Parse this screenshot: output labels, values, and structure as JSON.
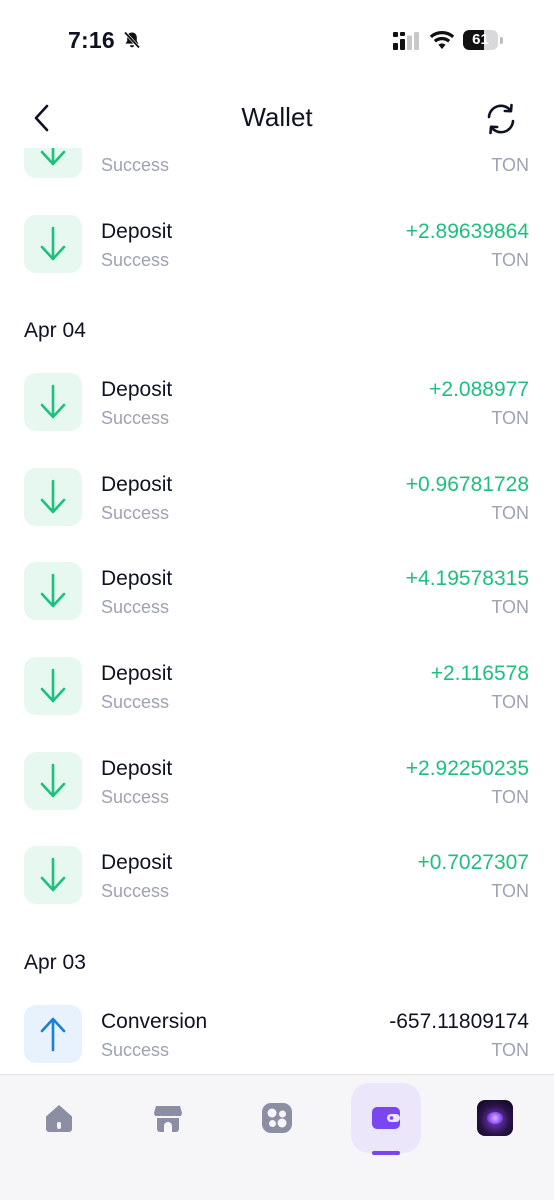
{
  "status_bar": {
    "time": "7:16",
    "battery": "61",
    "battery_level": 0.61
  },
  "header": {
    "title": "Wallet"
  },
  "partial_row": {
    "type": "in",
    "status": "Success",
    "currency": "TON"
  },
  "groups": [
    {
      "date": "",
      "rows": [
        {
          "type": "in",
          "title": "Deposit",
          "status": "Success",
          "amount": "+2.89639864",
          "currency": "TON"
        }
      ]
    },
    {
      "date": "Apr 04",
      "rows": [
        {
          "type": "in",
          "title": "Deposit",
          "status": "Success",
          "amount": "+2.088977",
          "currency": "TON"
        },
        {
          "type": "in",
          "title": "Deposit",
          "status": "Success",
          "amount": "+0.96781728",
          "currency": "TON"
        },
        {
          "type": "in",
          "title": "Deposit",
          "status": "Success",
          "amount": "+4.19578315",
          "currency": "TON"
        },
        {
          "type": "in",
          "title": "Deposit",
          "status": "Success",
          "amount": "+2.116578",
          "currency": "TON"
        },
        {
          "type": "in",
          "title": "Deposit",
          "status": "Success",
          "amount": "+2.92250235",
          "currency": "TON"
        },
        {
          "type": "in",
          "title": "Deposit",
          "status": "Success",
          "amount": "+0.7027307",
          "currency": "TON"
        }
      ]
    },
    {
      "date": "Apr 03",
      "rows": [
        {
          "type": "out",
          "title": "Conversion",
          "status": "Success",
          "amount": "-657.11809174",
          "currency": "TON"
        }
      ]
    }
  ],
  "nav": {
    "items": [
      {
        "icon": "home-icon"
      },
      {
        "icon": "store-icon"
      },
      {
        "icon": "apps-icon"
      },
      {
        "icon": "wallet-icon",
        "active": true
      },
      {
        "icon": "avatar"
      }
    ]
  },
  "colors": {
    "positive": "#1dc07c",
    "accent": "#7a45f2",
    "deposit_icon": "#1dc07c",
    "conversion_icon": "#1a7fd6"
  }
}
